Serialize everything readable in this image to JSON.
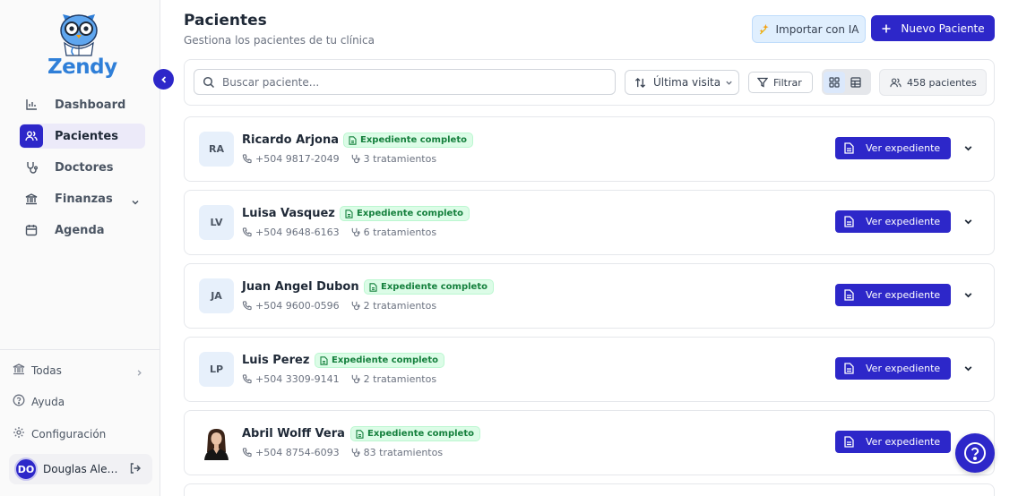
{
  "app": {
    "brand": "Zendy"
  },
  "sidebar": {
    "items": [
      {
        "label": "Dashboard",
        "icon": "bar-chart-icon",
        "active": false
      },
      {
        "label": "Pacientes",
        "icon": "users-icon",
        "active": true
      },
      {
        "label": "Doctores",
        "icon": "stethoscope-icon",
        "active": false
      },
      {
        "label": "Finanzas",
        "icon": "bank-icon",
        "active": false,
        "has_submenu": true
      },
      {
        "label": "Agenda",
        "icon": "calendar-icon",
        "active": false
      }
    ],
    "bottom": {
      "clinic_filter": "Todas",
      "help": "Ayuda",
      "settings": "Configuración"
    },
    "user": {
      "initials": "DO",
      "name": "Douglas Alejandro"
    }
  },
  "header": {
    "title": "Pacientes",
    "subtitle": "Gestiona los pacientes de tu clínica",
    "import_ai_label": "Importar con IA",
    "new_patient_label": "Nuevo Paciente"
  },
  "toolbar": {
    "search_placeholder": "Buscar paciente...",
    "sort_label": "Última visita",
    "filter_label": "Filtrar",
    "view_mode": "grid",
    "count_label": "458 pacientes"
  },
  "patients": [
    {
      "initials": "RA",
      "name": "Ricardo Arjona",
      "badge": "Expediente completo",
      "phone": "+504 9817-2049",
      "treatments": "3 tratamientos",
      "view_label": "Ver expediente"
    },
    {
      "initials": "LV",
      "name": "Luisa Vasquez",
      "badge": "Expediente completo",
      "phone": "+504 9648-6163",
      "treatments": "6 tratamientos",
      "view_label": "Ver expediente"
    },
    {
      "initials": "JA",
      "name": "Juan Angel Dubon",
      "badge": "Expediente completo",
      "phone": "+504 9600-0596",
      "treatments": "2 tratamientos",
      "view_label": "Ver expediente"
    },
    {
      "initials": "LP",
      "name": "Luis Perez",
      "badge": "Expediente completo",
      "phone": "+504 3309-9141",
      "treatments": "2 tratamientos",
      "view_label": "Ver expediente"
    },
    {
      "initials": "",
      "name": "Abril Wolff Vera",
      "badge": "Expediente completo",
      "phone": "+504 8754-6093",
      "treatments": "83 tratamientos",
      "view_label": "Ver expediente",
      "has_photo": true
    }
  ],
  "colors": {
    "primary": "#2d27c9",
    "brand_blue": "#2f7fd8",
    "badge_green": "#15803d",
    "badge_bg": "#dcfce7"
  }
}
